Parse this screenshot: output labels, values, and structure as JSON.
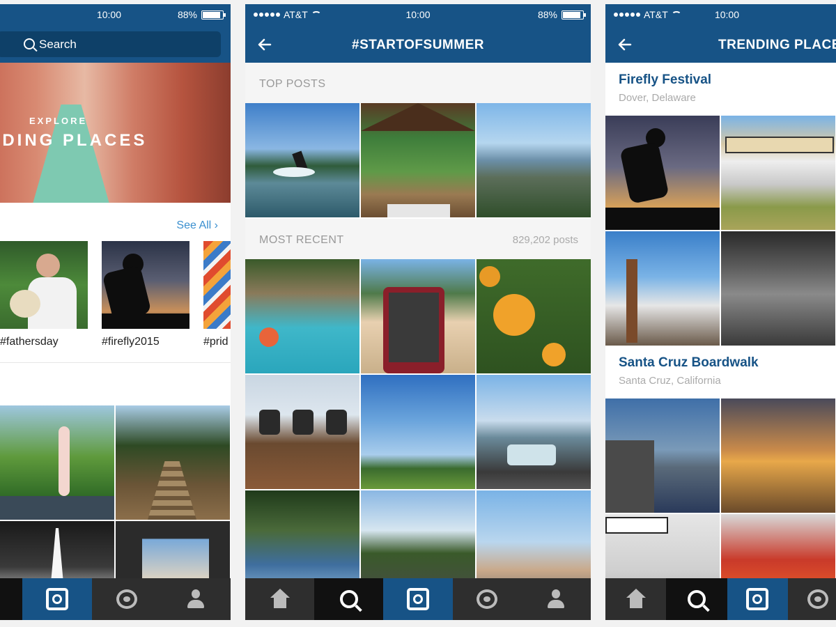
{
  "phones": [
    {
      "status": {
        "time": "10:00",
        "battery": "88%",
        "battery_level": 0.88
      },
      "search": {
        "label": "Search"
      },
      "hero": {
        "kicker": "EXPLORE",
        "headline": "NDING PLACES"
      },
      "see_all": "See All ›",
      "hashtags": [
        "#fathersday",
        "#firefly2015",
        "#prid"
      ],
      "tabs": [
        "explore-icon",
        "chat-icon",
        "profile-icon"
      ],
      "active_tab": "explore-icon"
    },
    {
      "status": {
        "carrier": "AT&T",
        "time": "10:00",
        "battery": "88%",
        "battery_level": 0.88
      },
      "nav": {
        "title": "#STARTOFSUMMER"
      },
      "top_posts": {
        "label": "TOP POSTS"
      },
      "most_recent": {
        "label": "MOST RECENT",
        "count": "829,202 posts"
      },
      "tabs": [
        "home-icon",
        "search-icon",
        "explore-icon",
        "chat-icon",
        "profile-icon"
      ],
      "active_tab": "explore-icon"
    },
    {
      "status": {
        "carrier": "AT&T",
        "time": "10:00"
      },
      "nav": {
        "title": "TRENDING PLACES"
      },
      "places": [
        {
          "name": "Firefly Festival",
          "location": "Dover, Delaware"
        },
        {
          "name": "Santa Cruz Boardwalk",
          "location": "Santa Cruz, California"
        }
      ],
      "tabs": [
        "home-icon",
        "search-icon",
        "explore-icon",
        "chat-icon"
      ],
      "active_tab": "explore-icon"
    }
  ],
  "colors": {
    "brand": "#175386",
    "link": "#3a8fcf",
    "tabbar": "#2e2e2e"
  }
}
